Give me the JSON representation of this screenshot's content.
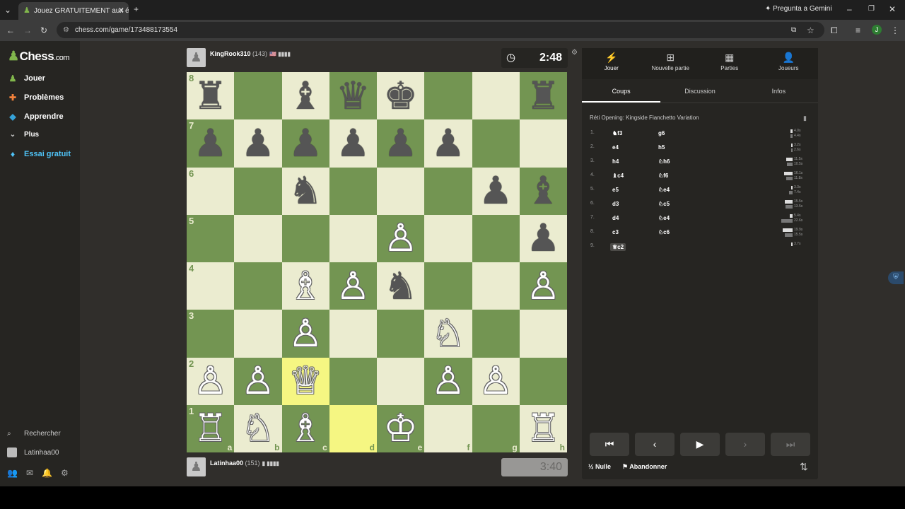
{
  "browser": {
    "tab_title": "Jouez GRATUITEMENT aux échecs",
    "url": "chess.com/game/173488173554",
    "gemini_label": "Pregunta a Gemini"
  },
  "sidebar": {
    "logo_text": "Chess",
    "logo_suffix": ".com",
    "items": [
      {
        "label": "Jouer",
        "icon": "play-pawn-icon"
      },
      {
        "label": "Problèmes",
        "icon": "puzzle-icon"
      },
      {
        "label": "Apprendre",
        "icon": "graduation-cap-icon"
      },
      {
        "label": "Plus",
        "icon": "chevron-down-icon"
      },
      {
        "label": "Essai gratuit",
        "icon": "diamond-icon"
      }
    ],
    "search_label": "Rechercher",
    "user_label": "Latinhaa00"
  },
  "top_player": {
    "name": "KingRook310",
    "rating": "(143)",
    "flag": "🇺🇸 ▮▮▮▮"
  },
  "bottom_player": {
    "name": "Latinhaa00",
    "rating": "(151)",
    "flag": "▮ ▮▮▮▮"
  },
  "clocks": {
    "top": "2:48",
    "bottom": "3:40"
  },
  "board": {
    "ranks": [
      "8",
      "7",
      "6",
      "5",
      "4",
      "3",
      "2",
      "1"
    ],
    "files": [
      "a",
      "b",
      "c",
      "d",
      "e",
      "f",
      "g",
      "h"
    ],
    "rows": [
      [
        "♜",
        "",
        "♝",
        "♛",
        "♚",
        "",
        "",
        "♜"
      ],
      [
        "♟",
        "♟",
        "♟",
        "♟",
        "♟",
        "♟",
        "",
        ""
      ],
      [
        "",
        "",
        "♞",
        "",
        "",
        "",
        "♟",
        "♝"
      ],
      [
        "",
        "",
        "",
        "",
        "♙",
        "",
        "",
        "♟"
      ],
      [
        "",
        "",
        "♗",
        "♙",
        "♞",
        "",
        "",
        "♙"
      ],
      [
        "",
        "",
        "♙",
        "",
        "",
        "♘",
        "",
        ""
      ],
      [
        "♙",
        "♙",
        "♕",
        "",
        "",
        "♙",
        "♙",
        ""
      ],
      [
        "♖",
        "♘",
        "♗",
        "",
        "♔",
        "",
        "",
        "♖"
      ]
    ],
    "colors": [
      [
        "b",
        "",
        "b",
        "b",
        "b",
        "",
        "",
        "b"
      ],
      [
        "b",
        "b",
        "b",
        "b",
        "b",
        "b",
        "",
        ""
      ],
      [
        "",
        "",
        "b",
        "",
        "",
        "",
        "b",
        "b"
      ],
      [
        "",
        "",
        "",
        "",
        "w",
        "",
        "",
        "b"
      ],
      [
        "",
        "",
        "w",
        "w",
        "b",
        "",
        "",
        "w"
      ],
      [
        "",
        "",
        "w",
        "",
        "",
        "w",
        "",
        ""
      ],
      [
        "w",
        "w",
        "w",
        "",
        "",
        "w",
        "w",
        ""
      ],
      [
        "w",
        "w",
        "w",
        "",
        "w",
        "",
        "",
        "w"
      ]
    ],
    "highlights": [
      "c2",
      "d1"
    ]
  },
  "panel": {
    "tabs": [
      {
        "label": "Jouer",
        "icon": "lightning-icon"
      },
      {
        "label": "Nouvelle partie",
        "icon": "plus-square-icon"
      },
      {
        "label": "Parties",
        "icon": "chessboard-icon"
      },
      {
        "label": "Joueurs",
        "icon": "players-icon"
      }
    ],
    "subtabs": [
      "Coups",
      "Discussion",
      "Infos"
    ],
    "opening": "Réti Opening: Kingside Fianchetto Variation",
    "moves": [
      {
        "n": "1.",
        "w": "♞f3",
        "b": "g6",
        "tw": "4.0s",
        "tb": "4.4s",
        "bw": 3,
        "bb": 3
      },
      {
        "n": "2.",
        "w": "e4",
        "b": "h5",
        "tw": "3.2s",
        "tb": "2.6s",
        "bw": 2,
        "bb": 2
      },
      {
        "n": "3.",
        "w": "h4",
        "b": "♘h6",
        "tw": "11.5s",
        "tb": "10.5s",
        "bw": 9,
        "bb": 8
      },
      {
        "n": "4.",
        "w": "♝c4",
        "b": "♘f6",
        "tw": "16.1s",
        "tb": "11.8s",
        "bw": 12,
        "bb": 9
      },
      {
        "n": "5.",
        "w": "e5",
        "b": "♘e4",
        "tw": "3.3s",
        "tb": "7.4s",
        "bw": 2,
        "bb": 5
      },
      {
        "n": "6.",
        "w": "d3",
        "b": "♘c5",
        "tw": "15.5s",
        "tb": "13.5s",
        "bw": 11,
        "bb": 10
      },
      {
        "n": "7.",
        "w": "d4",
        "b": "♘e4",
        "tw": "5.4s",
        "tb": "22.6s",
        "bw": 4,
        "bb": 16
      },
      {
        "n": "8.",
        "w": "c3",
        "b": "♘c6",
        "tw": "19.9s",
        "tb": "15.5s",
        "bw": 14,
        "bb": 11
      },
      {
        "n": "9.",
        "w": "♕c2",
        "b": "",
        "tw": "3.7s",
        "tb": "",
        "bw": 2,
        "bb": 0
      }
    ],
    "draw_label": "Nulle",
    "resign_label": "Abandonner"
  }
}
